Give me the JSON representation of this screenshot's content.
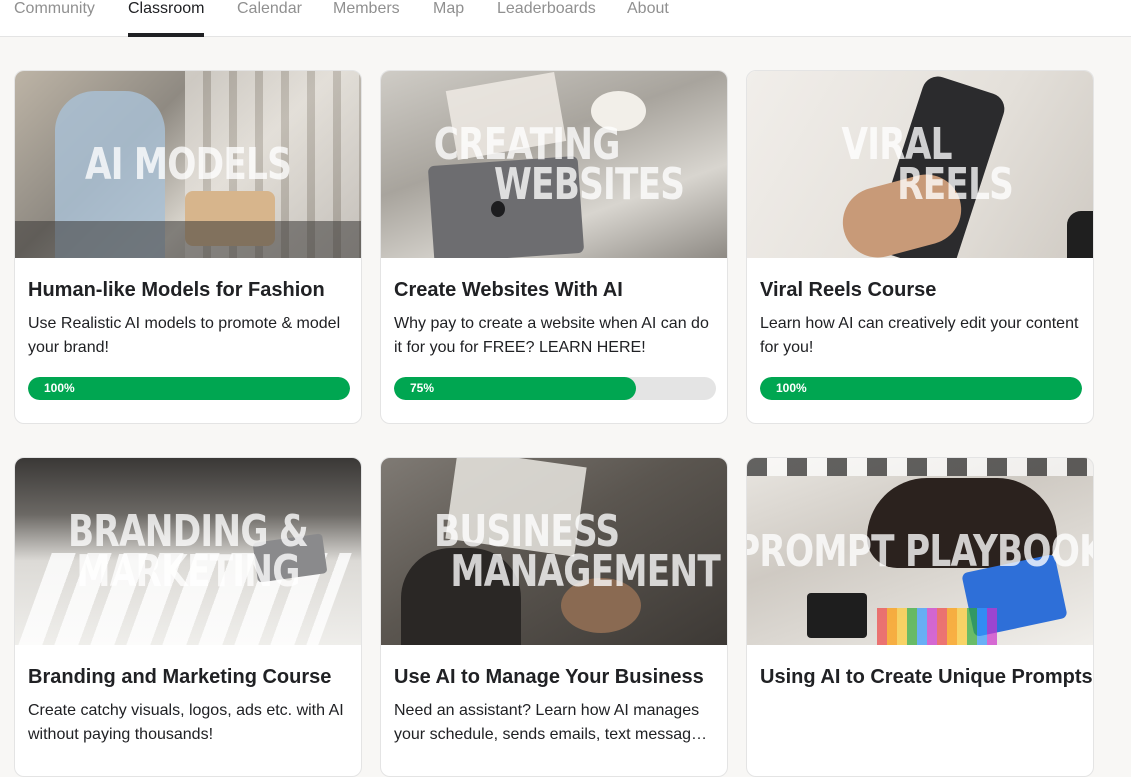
{
  "nav": {
    "tabs": [
      {
        "label": "Community",
        "active": false
      },
      {
        "label": "Classroom",
        "active": true
      },
      {
        "label": "Calendar",
        "active": false
      },
      {
        "label": "Members",
        "active": false
      },
      {
        "label": "Map",
        "active": false
      },
      {
        "label": "Leaderboards",
        "active": false
      },
      {
        "label": "About",
        "active": false
      }
    ]
  },
  "courses": [
    {
      "thumb_lines": [
        "AI MODELS"
      ],
      "title": "Human-like Models for Fashion",
      "description": "Use Realistic AI models to promote & model your brand!",
      "progress_label": "100%",
      "progress": 1.0
    },
    {
      "thumb_lines": [
        "CREATING",
        "WEBSITES"
      ],
      "title": "Create Websites With AI",
      "description": "Why pay to create a website when AI can do it for you for FREE? LEARN HERE!",
      "progress_label": "75%",
      "progress": 0.75
    },
    {
      "thumb_lines": [
        "VIRAL",
        "REELS"
      ],
      "title": "Viral Reels Course",
      "description": "Learn how AI can creatively edit your content for you!",
      "progress_label": "100%",
      "progress": 1.0
    },
    {
      "thumb_lines": [
        "BRANDING &",
        "MARKETING"
      ],
      "title": "Branding and Marketing Course",
      "description": "Create catchy visuals, logos, ads etc. with AI without paying thousands!"
    },
    {
      "thumb_lines": [
        "BUSINESS",
        "MANAGEMENT"
      ],
      "title": "Use AI to Manage Your Business",
      "description": "Need an assistant? Learn how AI manages your schedule, sends emails, text messages and more!"
    },
    {
      "thumb_lines": [
        "PROMPT PLAYBOOK"
      ],
      "title": "Using AI to Create Unique Prompts",
      "description": ""
    }
  ],
  "colors": {
    "progress_fill": "#00a651",
    "progress_track": "#e4e4e4",
    "active_tab": "#202124",
    "inactive_tab": "#909090"
  }
}
